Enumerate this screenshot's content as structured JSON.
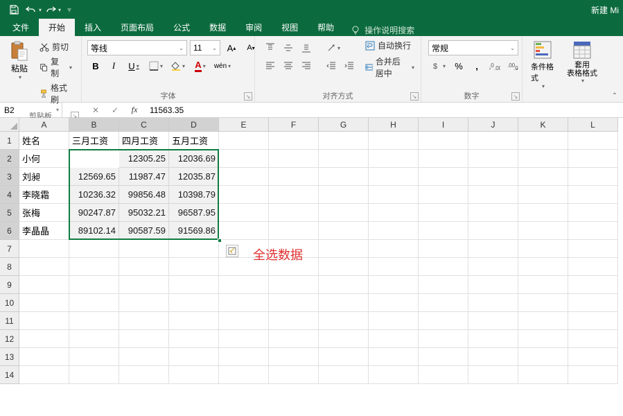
{
  "title": "新建 Mi",
  "qat": {
    "save": "save",
    "undo": "undo",
    "redo": "redo"
  },
  "tabs": [
    "文件",
    "开始",
    "插入",
    "页面布局",
    "公式",
    "数据",
    "审阅",
    "视图",
    "帮助"
  ],
  "active_tab": 1,
  "tellme": "操作说明搜索",
  "ribbon": {
    "clipboard": {
      "label": "剪贴板",
      "paste": "粘贴",
      "cut": "剪切",
      "copy": "复制",
      "painter": "格式刷"
    },
    "font": {
      "label": "字体",
      "name": "等线",
      "size": "11",
      "bold": "B",
      "italic": "I",
      "underline": "U"
    },
    "alignment": {
      "label": "对齐方式",
      "wrap": "自动换行",
      "merge": "合并后居中"
    },
    "number": {
      "label": "数字",
      "format": "常规"
    },
    "styles": {
      "cond": "条件格式",
      "table": "套用\n表格格式"
    }
  },
  "namebox": "B2",
  "formula": "11563.35",
  "columns": [
    "A",
    "B",
    "C",
    "D",
    "E",
    "F",
    "G",
    "H",
    "I",
    "J",
    "K",
    "L"
  ],
  "row_count": 14,
  "sheet": {
    "headers": [
      "姓名",
      "三月工资",
      "四月工资",
      "五月工资"
    ],
    "rows": [
      {
        "name": "小何",
        "m3": "11563.35",
        "m4": "12305.25",
        "m5": "12036.69"
      },
      {
        "name": "刘昶",
        "m3": "12569.65",
        "m4": "11987.47",
        "m5": "12035.87"
      },
      {
        "name": "李晓霜",
        "m3": "10236.32",
        "m4": "99856.48",
        "m5": "10398.79"
      },
      {
        "name": "张梅",
        "m3": "90247.87",
        "m4": "95032.21",
        "m5": "96587.95"
      },
      {
        "name": "李晶晶",
        "m3": "89102.14",
        "m4": "90587.59",
        "m5": "91569.86"
      }
    ]
  },
  "selection": {
    "ref": "B2:D6",
    "active": "B2"
  },
  "chart_data": {
    "type": "table",
    "categories": [
      "小何",
      "刘昶",
      "李晓霜",
      "张梅",
      "李晶晶"
    ],
    "series": [
      {
        "name": "三月工资",
        "values": [
          11563.35,
          12569.65,
          10236.32,
          90247.87,
          89102.14
        ]
      },
      {
        "name": "四月工资",
        "values": [
          12305.25,
          11987.47,
          99856.48,
          95032.21,
          90587.59
        ]
      },
      {
        "name": "五月工资",
        "values": [
          12036.69,
          12035.87,
          10398.79,
          96587.95,
          91569.86
        ]
      }
    ]
  },
  "annotation": "全选数据"
}
